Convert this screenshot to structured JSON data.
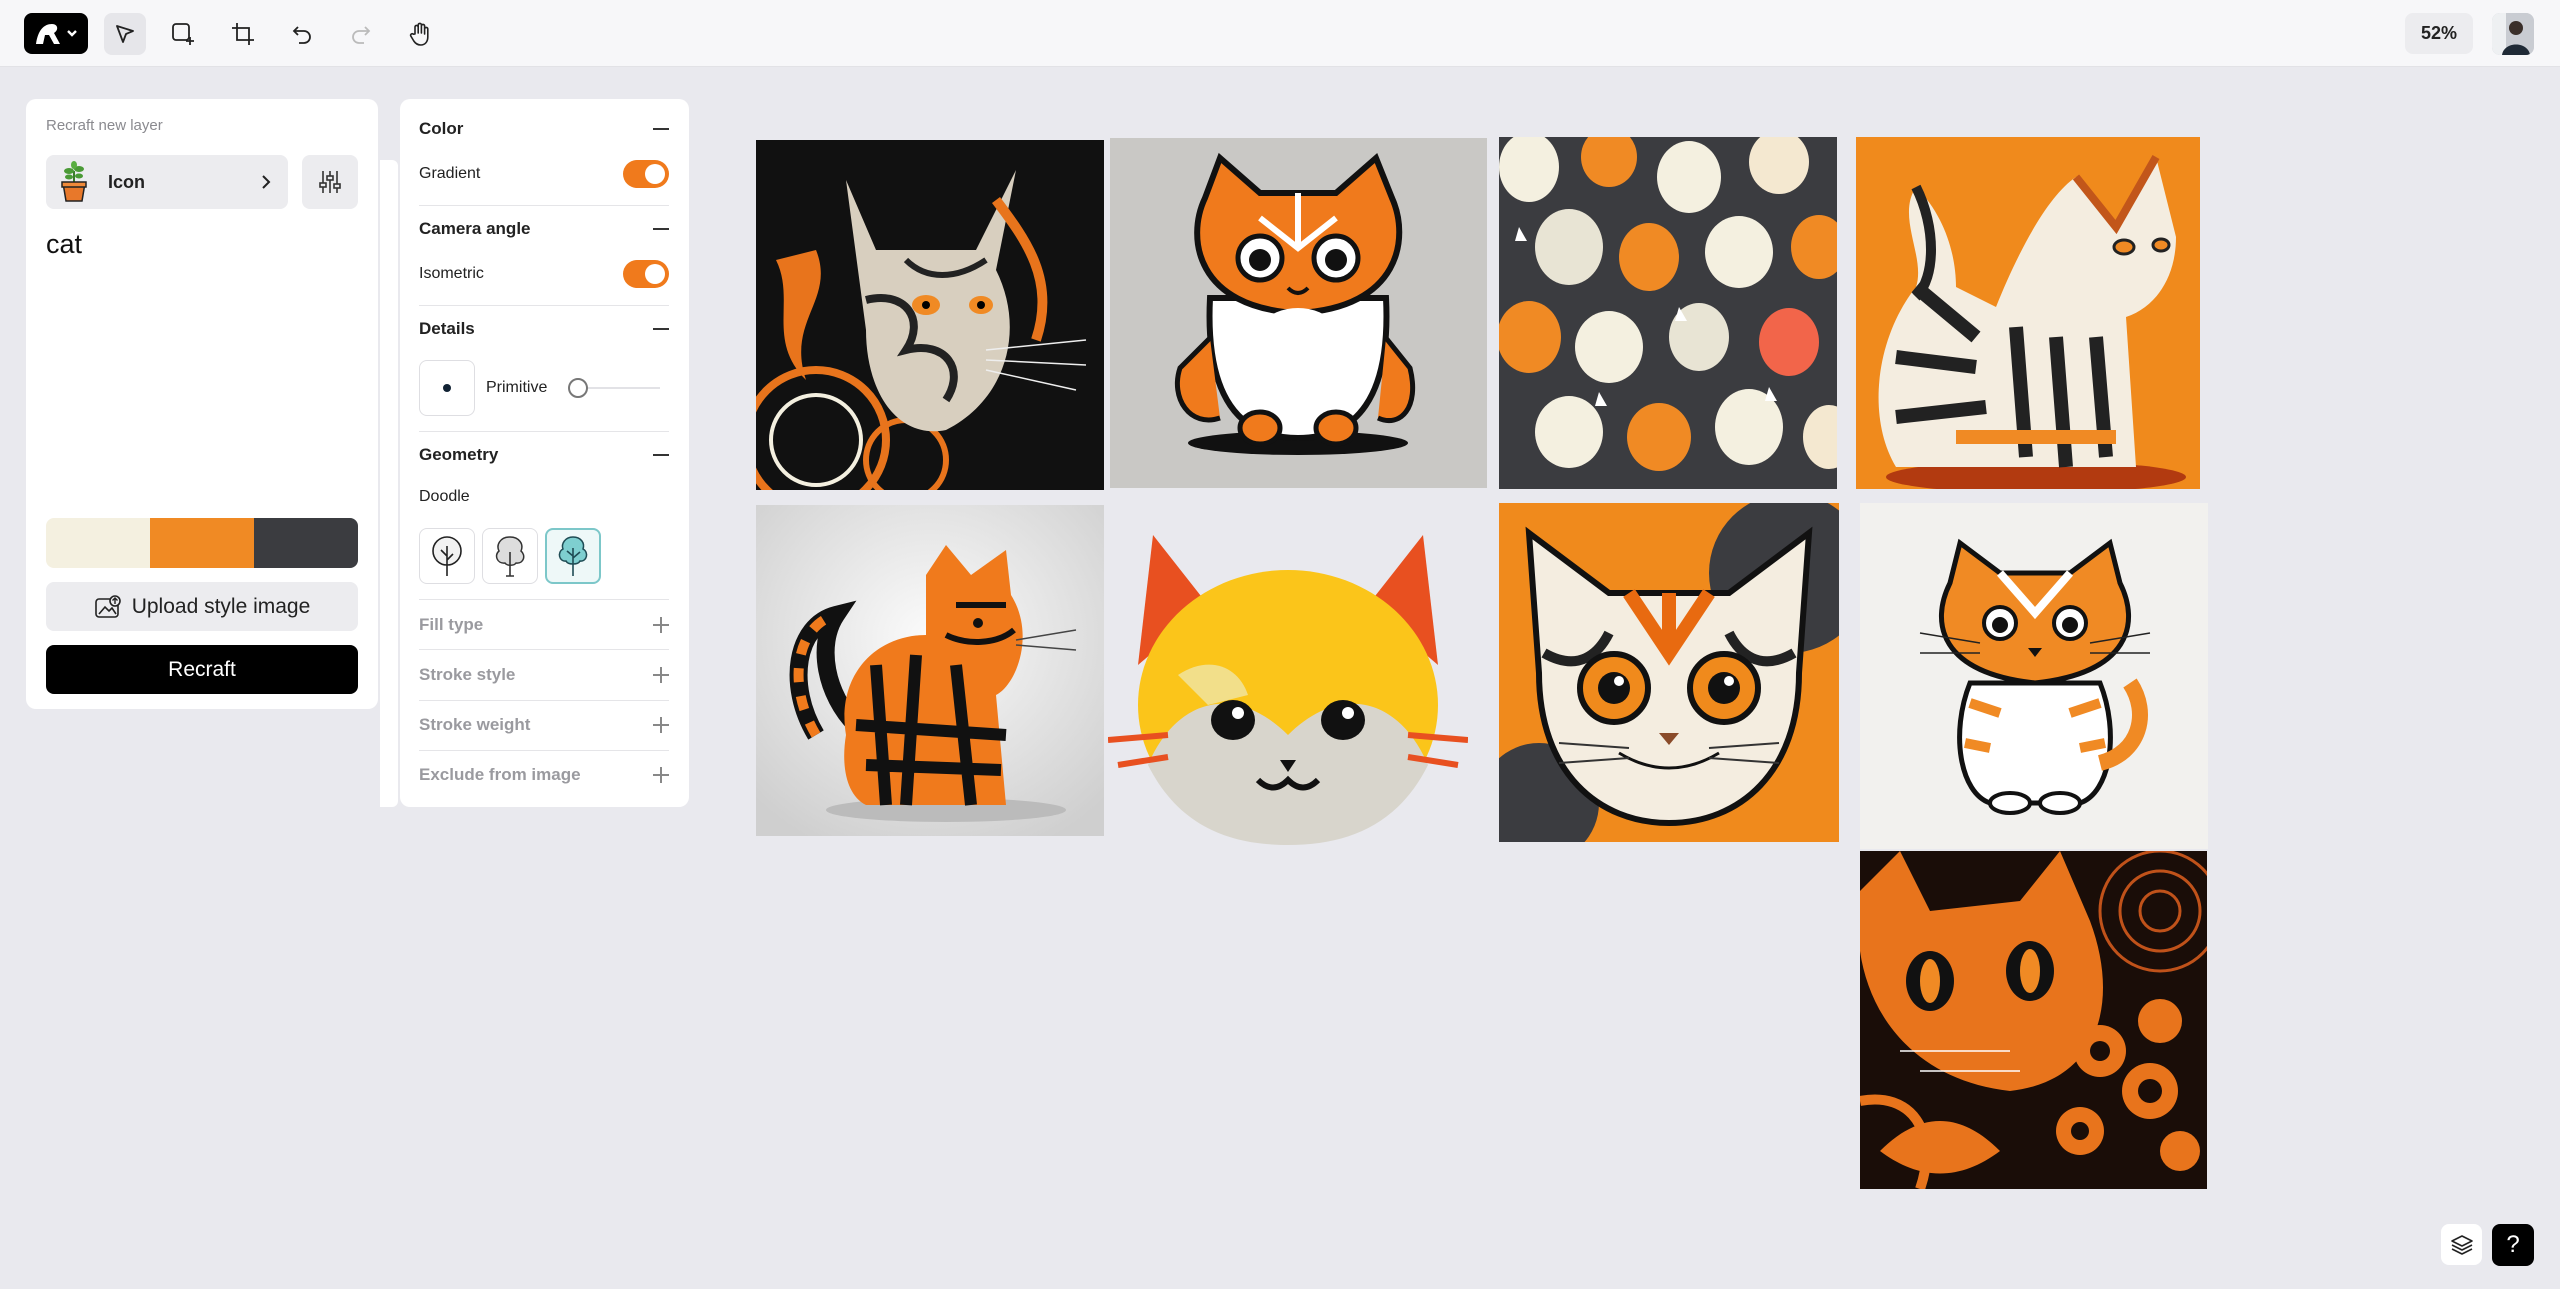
{
  "topbar": {
    "zoom": "52%",
    "tools": [
      "select-tool",
      "add-frame-tool",
      "crop-tool",
      "undo",
      "redo",
      "hand-tool"
    ]
  },
  "left_panel": {
    "title": "Recraft new layer",
    "style_label": "Icon",
    "prompt": "cat",
    "palette": [
      "#f4f0e0",
      "#f08a24",
      "#3b3c40"
    ],
    "upload_label": "Upload style image",
    "recraft_label": "Recraft"
  },
  "settings": {
    "color": {
      "title": "Color",
      "gradient_label": "Gradient",
      "gradient_on": true
    },
    "camera": {
      "title": "Camera angle",
      "isometric_label": "Isometric",
      "isometric_on": true
    },
    "details": {
      "title": "Details",
      "primitive_label": "Primitive",
      "primitive_level": 0
    },
    "geometry": {
      "title": "Geometry",
      "doodle_label": "Doodle",
      "selected_option": 3
    },
    "collapsed": [
      "Fill type",
      "Stroke style",
      "Stroke weight",
      "Exclude from image"
    ]
  },
  "colors": {
    "accent": "#f07a1c",
    "canvas_bg": "#e9e9ee",
    "panel_bg": "#ffffff"
  },
  "help_label": "?"
}
